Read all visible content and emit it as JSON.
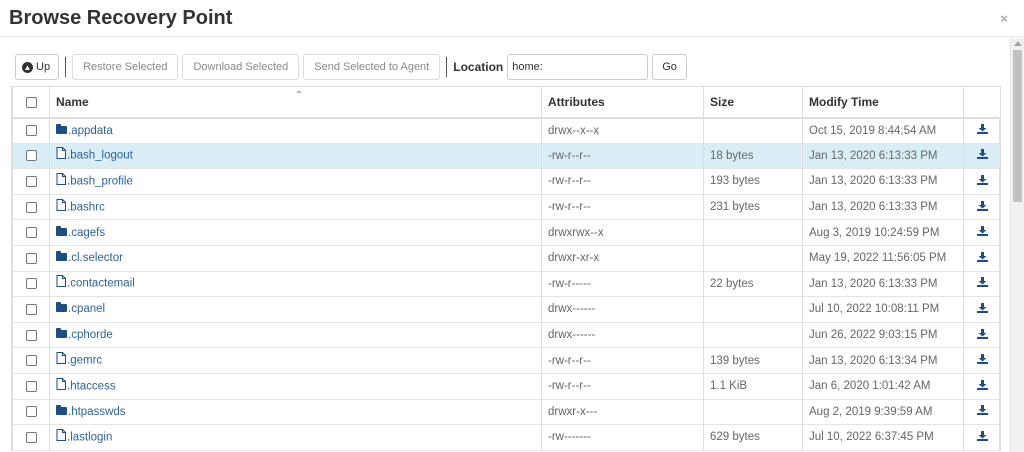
{
  "dialog": {
    "title": "Browse Recovery Point",
    "close_label": "×"
  },
  "toolbar": {
    "up_label": "Up",
    "restore_label": "Restore Selected",
    "download_label": "Download Selected",
    "send_label": "Send Selected to Agent",
    "location_label": "Location",
    "location_value": "home:",
    "go_label": "Go"
  },
  "table": {
    "columns": [
      "Name",
      "Attributes",
      "Size",
      "Modify Time"
    ],
    "rows": [
      {
        "name": ".appdata",
        "type": "folder",
        "attributes": "drwx--x--x",
        "size": "",
        "modified": "Oct 15, 2019 8:44:54 AM",
        "selected": false
      },
      {
        "name": ".bash_logout",
        "type": "file",
        "attributes": "-rw-r--r--",
        "size": "18 bytes",
        "modified": "Jan 13, 2020 6:13:33 PM",
        "selected": true
      },
      {
        "name": ".bash_profile",
        "type": "file",
        "attributes": "-rw-r--r--",
        "size": "193 bytes",
        "modified": "Jan 13, 2020 6:13:33 PM",
        "selected": false
      },
      {
        "name": ".bashrc",
        "type": "file",
        "attributes": "-rw-r--r--",
        "size": "231 bytes",
        "modified": "Jan 13, 2020 6:13:33 PM",
        "selected": false
      },
      {
        "name": ".cagefs",
        "type": "folder",
        "attributes": "drwxrwx--x",
        "size": "",
        "modified": "Aug 3, 2019 10:24:59 PM",
        "selected": false
      },
      {
        "name": ".cl.selector",
        "type": "folder",
        "attributes": "drwxr-xr-x",
        "size": "",
        "modified": "May 19, 2022 11:56:05 PM",
        "selected": false
      },
      {
        "name": ".contactemail",
        "type": "file",
        "attributes": "-rw-r-----",
        "size": "22 bytes",
        "modified": "Jan 13, 2020 6:13:33 PM",
        "selected": false
      },
      {
        "name": ".cpanel",
        "type": "folder",
        "attributes": "drwx------",
        "size": "",
        "modified": "Jul 10, 2022 10:08:11 PM",
        "selected": false
      },
      {
        "name": ".cphorde",
        "type": "folder",
        "attributes": "drwx------",
        "size": "",
        "modified": "Jun 26, 2022 9:03:15 PM",
        "selected": false
      },
      {
        "name": ".gemrc",
        "type": "file",
        "attributes": "-rw-r--r--",
        "size": "139 bytes",
        "modified": "Jan 13, 2020 6:13:34 PM",
        "selected": false
      },
      {
        "name": ".htaccess",
        "type": "file",
        "attributes": "-rw-r--r--",
        "size": "1.1 KiB",
        "modified": "Jan 6, 2020 1:01:42 AM",
        "selected": false
      },
      {
        "name": ".htpasswds",
        "type": "folder",
        "attributes": "drwxr-x---",
        "size": "",
        "modified": "Aug 2, 2019 9:39:59 AM",
        "selected": false
      },
      {
        "name": ".lastlogin",
        "type": "file",
        "attributes": "-rw-------",
        "size": "629 bytes",
        "modified": "Jul 10, 2022 6:37:45 PM",
        "selected": false
      }
    ]
  },
  "colors": {
    "selected_row": "#d9edf7",
    "link": "#2f6397",
    "icon": "#1f4d80"
  },
  "icons": {
    "up": "arrow-circle-up-icon",
    "folder": "folder-icon",
    "file": "file-icon",
    "download": "download-icon",
    "close": "close-icon"
  }
}
